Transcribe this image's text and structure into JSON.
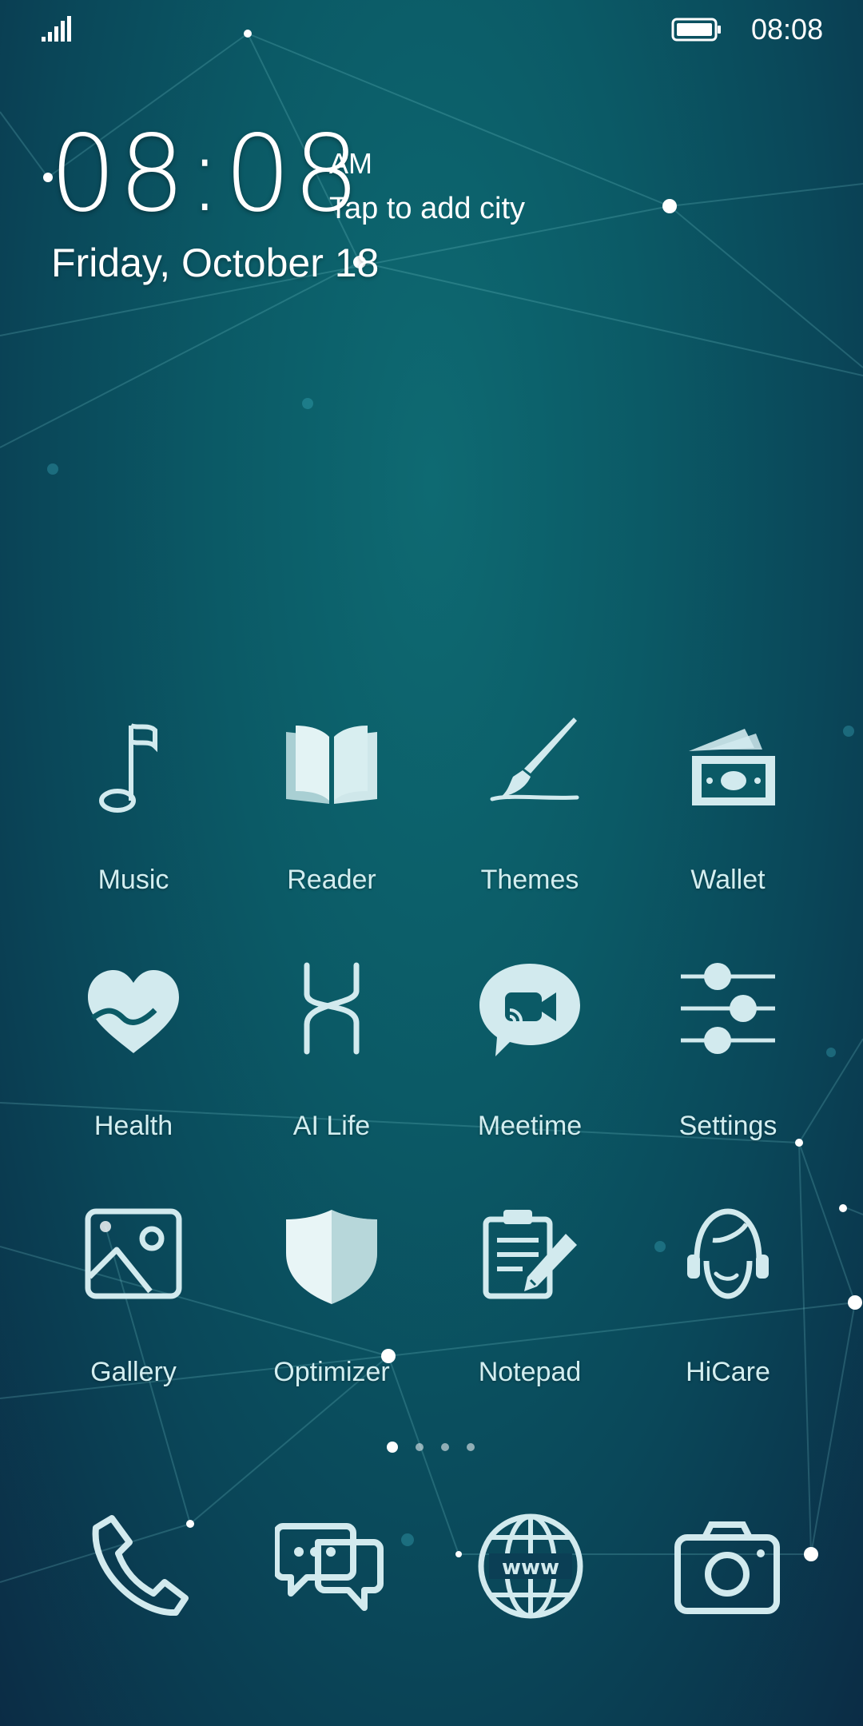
{
  "status_bar": {
    "time": "08:08",
    "signal_icon": "signal-icon",
    "battery_icon": "battery-icon"
  },
  "clock_widget": {
    "time": "08:08",
    "ampm": "AM",
    "city_prompt": "Tap to add city",
    "date": "Friday, October 18"
  },
  "apps": [
    {
      "label": "Music",
      "icon": "music-note-icon"
    },
    {
      "label": "Reader",
      "icon": "book-icon"
    },
    {
      "label": "Themes",
      "icon": "paintbrush-icon"
    },
    {
      "label": "Wallet",
      "icon": "wallet-icon"
    },
    {
      "label": "Health",
      "icon": "heart-icon"
    },
    {
      "label": "AI Life",
      "icon": "ai-life-icon"
    },
    {
      "label": "Meetime",
      "icon": "video-chat-icon"
    },
    {
      "label": "Settings",
      "icon": "sliders-icon"
    },
    {
      "label": "Gallery",
      "icon": "image-icon"
    },
    {
      "label": "Optimizer",
      "icon": "shield-icon"
    },
    {
      "label": "Notepad",
      "icon": "notepad-icon"
    },
    {
      "label": "HiCare",
      "icon": "headset-icon"
    }
  ],
  "page_indicator": {
    "pages": 4,
    "current": 1
  },
  "dock": [
    {
      "icon": "phone-icon"
    },
    {
      "icon": "messages-icon"
    },
    {
      "icon": "browser-icon"
    },
    {
      "icon": "camera-icon"
    }
  ],
  "colors": {
    "icon_tint": "#d2eaee",
    "background_top": "#0e6a72",
    "background_bottom": "#0b2c45"
  }
}
